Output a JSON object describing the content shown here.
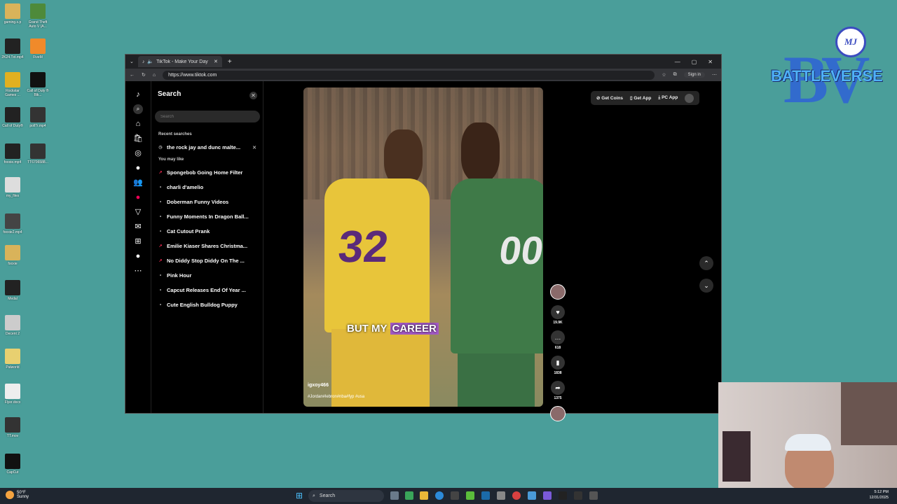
{
  "desktop": {
    "icons": [
      {
        "label": "gaming.s.p",
        "color": "#d9b35a"
      },
      {
        "label": "Grand Theft Auto V (A...",
        "color": "#4e8a3a"
      },
      {
        "label": "2K24.Txt.mp4",
        "color": "#222"
      },
      {
        "label": "FiveM",
        "color": "#f08a2a"
      },
      {
        "label": "Rockstar Games ...",
        "color": "#e0b020"
      },
      {
        "label": "Call of Duty ® Blk...",
        "color": "#111"
      },
      {
        "label": "Call of Duty®",
        "color": "#222"
      },
      {
        "label": "pollTr.mp4",
        "color": "#333"
      },
      {
        "label": "fooxie.mp4",
        "color": "#222"
      },
      {
        "label": "TT6706588...",
        "color": "#333"
      },
      {
        "label": "my_files",
        "color": "#ddd"
      },
      {
        "label": "fooxie2.mp4",
        "color": "#444"
      },
      {
        "label": "fooxie",
        "color": "#d9b35a"
      },
      {
        "label": "Medal",
        "color": "#222"
      },
      {
        "label": "Decent 2",
        "color": "#ccc"
      },
      {
        "label": "Palworld",
        "color": "#e8d070"
      },
      {
        "label": "Flyer.docx",
        "color": "#eee"
      },
      {
        "label": "TT.mov",
        "color": "#333"
      },
      {
        "label": "CapCut",
        "color": "#111"
      }
    ]
  },
  "browser": {
    "tab_title": "TikTok - Make Your Day",
    "url": "https://www.tiktok.com",
    "sign_in": "Sign in"
  },
  "search_panel": {
    "title": "Search",
    "placeholder": "Search",
    "recent_heading": "Recent searches",
    "recent": [
      "the rock jay and dunc malte..."
    ],
    "suggest_heading": "You may like",
    "suggestions": [
      {
        "text": "Spongebob Going Home Filter",
        "trending": true
      },
      {
        "text": "charli d'amelio",
        "trending": false
      },
      {
        "text": "Doberman Funny Videos",
        "trending": false
      },
      {
        "text": "Funny Moments In Dragon Ball...",
        "trending": false
      },
      {
        "text": "Cat Cutout Prank",
        "trending": false
      },
      {
        "text": "Emilie Kiaser Shares Christma...",
        "trending": true
      },
      {
        "text": "No Diddy Stop Diddy On The ...",
        "trending": true
      },
      {
        "text": "Pink Hour",
        "trending": false
      },
      {
        "text": "Capcut Releases End Of Year ...",
        "trending": false
      },
      {
        "text": "Cute English Bulldog Puppy",
        "trending": false
      }
    ]
  },
  "video": {
    "caption_plain": "BUT MY",
    "caption_highlight": "CAREER",
    "jersey_left": "32",
    "jersey_right": "00",
    "username": "igxoy466",
    "tags": "#Jordan#lebron#nba#fyp #usa",
    "likes": "19.9K",
    "comments": "618",
    "saves": "1838",
    "shares": "1375"
  },
  "top_buttons": {
    "coins": "Get Coins",
    "app": "Get App",
    "pc": "PC App"
  },
  "logo": {
    "text": "BATTLEVERSE",
    "monogram": "MJ",
    "letters": "BV"
  },
  "taskbar": {
    "temp": "50°F",
    "weather": "Sunny",
    "search": "Search",
    "time": "5:12 PM",
    "date": "12/31/2025"
  }
}
